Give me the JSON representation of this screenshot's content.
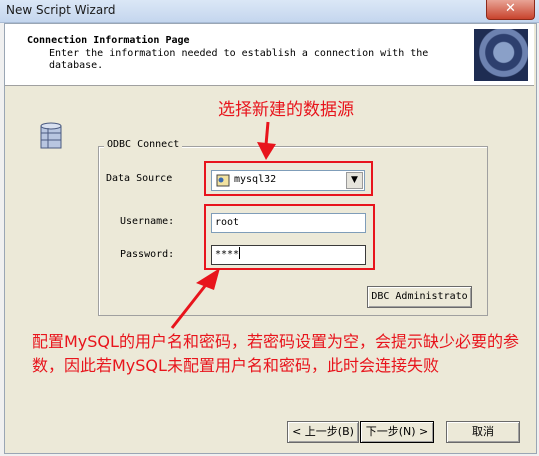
{
  "window": {
    "title": "New Script Wizard",
    "close_glyph": "✕"
  },
  "header": {
    "title": "Connection Information Page",
    "description": "Enter the information needed to establish a connection with the database."
  },
  "odbc": {
    "group_label": "ODBC Connect",
    "data_source_label": "Data Source",
    "data_source_value": "mysql32",
    "username_label": "Username:",
    "username_value": "root",
    "password_label": "Password:",
    "password_value": "****",
    "dbc_button_label": "DBC Administrato"
  },
  "annotations": {
    "top": "选择新建的数据源",
    "bottom": "配置MySQL的用户名和密码，若密码设置为空，会提示缺少必要的参数，因此若MySQL未配置用户名和密码，此时会连接失败"
  },
  "buttons": {
    "back": "< 上一步(B)",
    "next": "下一步(N) >",
    "cancel": "取消"
  },
  "colors": {
    "annotation_red": "#e8141c",
    "header_bg": "#ffffff",
    "dialog_bg": "#ece9d8"
  }
}
